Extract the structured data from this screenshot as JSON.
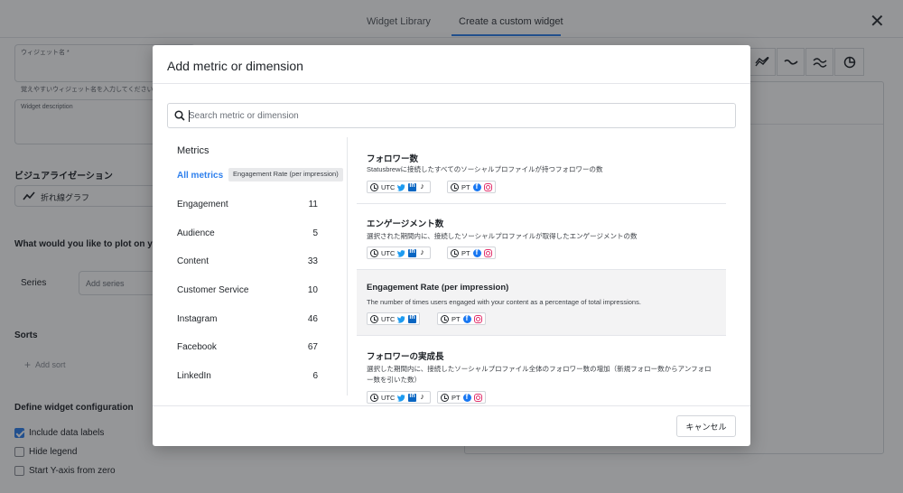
{
  "top_tabs": [
    {
      "label": "Widget Library"
    },
    {
      "label": "Create a custom widget",
      "active": true
    }
  ],
  "form": {
    "widget_name_label": "ウィジェット名 *",
    "widget_name_help": "覚えやすいウィジェット名を入力してください",
    "widget_description_label": "Widget description",
    "visualization_title": "ビジュアライゼーション",
    "visualization_value": "折れ線グラフ",
    "plot_question": "What would you like to plot on you",
    "series_label": "Series",
    "series_placeholder": "Add series",
    "sorts_title": "Sorts",
    "add_sort_label": "Add sort",
    "config_title": "Define widget configuration",
    "checkboxes": [
      {
        "label": "Include data labels",
        "checked": true
      },
      {
        "label": "Hide legend",
        "checked": false
      },
      {
        "label": "Start Y-axis from zero",
        "checked": false
      }
    ]
  },
  "visualization_icons": [
    "multi-line-chart-icon",
    "step-line-icon",
    "area-wave-icon",
    "pie-chart-icon"
  ],
  "modal": {
    "title": "Add metric or dimension",
    "search_placeholder": "Search metric or dimension",
    "categories_heading": "Metrics",
    "tooltip": "Engagement Rate (per impression)",
    "categories": [
      {
        "label": "All metrics",
        "count": "",
        "active": true
      },
      {
        "label": "Engagement",
        "count": "11"
      },
      {
        "label": "Audience",
        "count": "5"
      },
      {
        "label": "Content",
        "count": "33"
      },
      {
        "label": "Customer Service",
        "count": "10"
      },
      {
        "label": "Instagram",
        "count": "46"
      },
      {
        "label": "Facebook",
        "count": "67"
      },
      {
        "label": "LinkedIn",
        "count": "6"
      }
    ],
    "metrics": [
      {
        "title": "フォロワー数",
        "description": "Statusbrewに接続したすべてのソーシャルプロファイルが持つフォロワーの数",
        "utc_label": "UTC",
        "pt_label": "PT",
        "utc_networks": [
          "twitter",
          "linkedin",
          "tiktok"
        ],
        "pt_networks": [
          "facebook",
          "instagram"
        ]
      },
      {
        "title": "エンゲージメント数",
        "description": "選択された期間内に、接続したソーシャルプロファイルが取得したエンゲージメントの数",
        "utc_label": "UTC",
        "pt_label": "PT",
        "utc_networks": [
          "twitter",
          "linkedin",
          "tiktok"
        ],
        "pt_networks": [
          "facebook",
          "instagram"
        ]
      },
      {
        "title": "Engagement Rate (per impression)",
        "description": "The number of times users engaged with your content as a percentage of total impressions.",
        "utc_label": "UTC",
        "pt_label": "PT",
        "utc_networks": [
          "twitter",
          "linkedin"
        ],
        "pt_networks": [
          "facebook",
          "instagram"
        ]
      },
      {
        "title": "フォロワーの実成長",
        "description": "選択した期間内に、接続したソーシャルプロファイル全体のフォロワー数の増加（新規フォロー数からアンフォロー数を引いた数）",
        "utc_label": "UTC",
        "pt_label": "PT",
        "utc_networks": [
          "twitter",
          "linkedin",
          "tiktok"
        ],
        "pt_networks": [
          "facebook",
          "instagram"
        ]
      }
    ],
    "cancel_label": "キャンセル"
  },
  "colors": {
    "accent": "#2f80ed",
    "overlay": "rgba(20,22,26,0.45)",
    "highlight_row": "#f3f3f4"
  }
}
